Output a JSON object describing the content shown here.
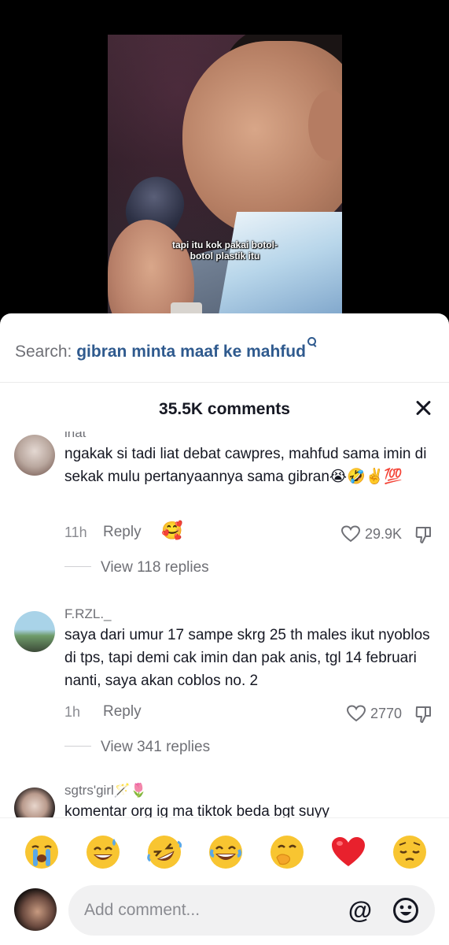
{
  "video": {
    "caption_line1": "tapi itu kok pakai botol-",
    "caption_line2": "botol plastik itu"
  },
  "search": {
    "prefix": "Search: ",
    "term": "gibran minta maaf ke mahfud"
  },
  "comments_header": {
    "count_label": "35.5K comments"
  },
  "comments": [
    {
      "username": "inat",
      "text": "ngakak si tadi liat debat cawpres, mahfud sama imin di sekak mulu pertanyaannya sama gibran😭🤣✌️💯",
      "time": "11h",
      "reply_label": "Reply",
      "likes": "29.9K",
      "reaction_emoji": "🥰",
      "view_replies": "View 118 replies"
    },
    {
      "username": "F.RZL._",
      "text": "saya dari umur 17 sampe skrg 25 th males ikut nyoblos di tps, tapi demi cak imin dan pak anis, tgl 14 februari nanti, saya akan coblos no. 2",
      "time": "1h",
      "reply_label": "Reply",
      "likes": "2770",
      "view_replies": "View 341 replies"
    },
    {
      "username": "sgtrs'girl🪄🌷",
      "text": "komentar org ig ma tiktok beda bgt suyy"
    }
  ],
  "emoji_bar": [
    "😭",
    "😅",
    "🤣",
    "😂",
    "🤭",
    "❤️",
    "😔"
  ],
  "input": {
    "placeholder": "Add comment...",
    "mention_label": "@"
  },
  "colors": {
    "search_term": "#2f5a8e",
    "text_primary": "#161823",
    "text_secondary": "#6f7076",
    "input_bg": "#f1f1f2"
  }
}
